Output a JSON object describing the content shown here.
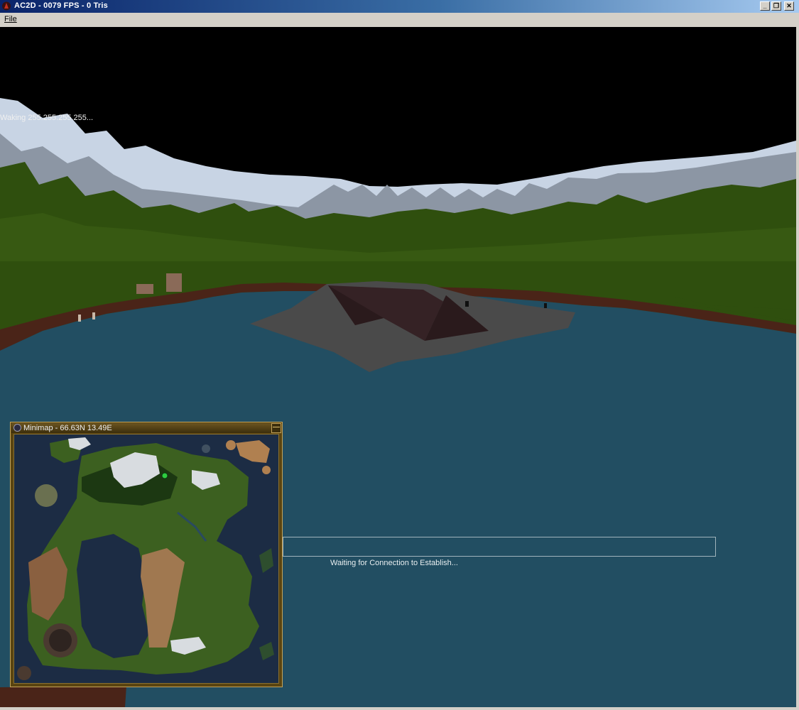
{
  "window": {
    "title": "AC2D - 0079 FPS - 0 Tris",
    "icon": "app-logo-icon",
    "buttons": [
      "minimize-icon",
      "restore-icon",
      "close-icon"
    ],
    "minimize_glyph": "_",
    "restore_glyph": "❐",
    "close_glyph": "✕"
  },
  "menu": {
    "file_label": "File"
  },
  "viewport": {
    "status_text": "Waking 255.255.255.255..."
  },
  "connection": {
    "progress": 0,
    "waiting_text": "Waiting for Connection to Establish..."
  },
  "minimap": {
    "title": "Minimap - 66.63N 13.49E",
    "minimize_glyph": "—"
  },
  "colors": {
    "sky": "#000000",
    "snow": "#c8d4e4",
    "rock": "#8c96a4",
    "forest": "#2f4f0e",
    "water": "#224e62",
    "titlebar_start": "#0a246a"
  }
}
